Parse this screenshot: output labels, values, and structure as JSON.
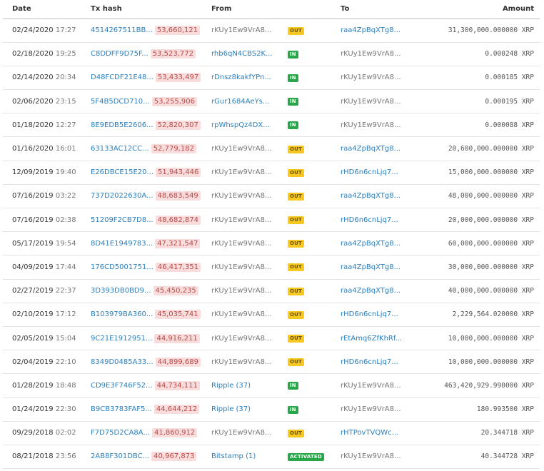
{
  "headers": {
    "date": "Date",
    "tx_hash": "Tx hash",
    "from": "From",
    "to": "To",
    "amount": "Amount"
  },
  "badge_colors": {
    "OUT": "#f7c81f",
    "IN": "#2aa64a",
    "ACTIVATED": "#2aa64a"
  },
  "rows": [
    {
      "date": "02/24/2020",
      "time": "17:27",
      "hash": "4514267511BB...",
      "ledger": "53,660,121",
      "from": "rKUy1Ew9VrA8...",
      "from_link": false,
      "type": "OUT",
      "to": "raa4ZpBqXTg8...",
      "to_link": true,
      "amount": "31,300,000.000000 XRP"
    },
    {
      "date": "02/18/2020",
      "time": "19:25",
      "hash": "C8DDFF9D75F...",
      "ledger": "53,523,772",
      "from": "rhb6qN4CBS2K...",
      "from_link": true,
      "type": "IN",
      "to": "rKUy1Ew9VrA8...",
      "to_link": false,
      "amount": "0.000248 XRP"
    },
    {
      "date": "02/14/2020",
      "time": "20:34",
      "hash": "D48FCDF21E48...",
      "ledger": "53,433,497",
      "from": "rDnsz8kakfYPn...",
      "from_link": true,
      "type": "IN",
      "to": "rKUy1Ew9VrA8...",
      "to_link": false,
      "amount": "0.000185 XRP"
    },
    {
      "date": "02/06/2020",
      "time": "23:15",
      "hash": "5F4B5DCD710...",
      "ledger": "53,255,906",
      "from": "rGur1684AeYs...",
      "from_link": true,
      "type": "IN",
      "to": "rKUy1Ew9VrA8...",
      "to_link": false,
      "amount": "0.000195 XRP"
    },
    {
      "date": "01/18/2020",
      "time": "12:27",
      "hash": "8E9EDB5E2606...",
      "ledger": "52,820,307",
      "from": "rpWhspQz4DX...",
      "from_link": true,
      "type": "IN",
      "to": "rKUy1Ew9VrA8...",
      "to_link": false,
      "amount": "0.000088 XRP"
    },
    {
      "date": "01/16/2020",
      "time": "16:01",
      "hash": "63133AC12CC...",
      "ledger": "52,779,182",
      "from": "rKUy1Ew9VrA8...",
      "from_link": false,
      "type": "OUT",
      "to": "raa4ZpBqXTg8...",
      "to_link": true,
      "amount": "20,600,000.000000 XRP"
    },
    {
      "date": "12/09/2019",
      "time": "19:40",
      "hash": "E26DBCE15E20...",
      "ledger": "51,943,446",
      "from": "rKUy1Ew9VrA8...",
      "from_link": false,
      "type": "OUT",
      "to": "rHD6n6cnLjq7...",
      "to_link": true,
      "amount": "15,000,000.000000 XRP"
    },
    {
      "date": "07/16/2019",
      "time": "03:22",
      "hash": "737D2022630A...",
      "ledger": "48,683,549",
      "from": "rKUy1Ew9VrA8...",
      "from_link": false,
      "type": "OUT",
      "to": "raa4ZpBqXTg8...",
      "to_link": true,
      "amount": "48,000,000.000000 XRP"
    },
    {
      "date": "07/16/2019",
      "time": "02:38",
      "hash": "51209F2CB7D8...",
      "ledger": "48,682,874",
      "from": "rKUy1Ew9VrA8...",
      "from_link": false,
      "type": "OUT",
      "to": "rHD6n6cnLjq7...",
      "to_link": true,
      "amount": "20,000,000.000000 XRP"
    },
    {
      "date": "05/17/2019",
      "time": "19:54",
      "hash": "8D41E1949783...",
      "ledger": "47,321,547",
      "from": "rKUy1Ew9VrA8...",
      "from_link": false,
      "type": "OUT",
      "to": "raa4ZpBqXTg8...",
      "to_link": true,
      "amount": "60,000,000.000000 XRP"
    },
    {
      "date": "04/09/2019",
      "time": "17:44",
      "hash": "176CD5001751...",
      "ledger": "46,417,351",
      "from": "rKUy1Ew9VrA8...",
      "from_link": false,
      "type": "OUT",
      "to": "raa4ZpBqXTg8...",
      "to_link": true,
      "amount": "30,000,000.000000 XRP"
    },
    {
      "date": "02/27/2019",
      "time": "22:37",
      "hash": "3D393DB0BD9...",
      "ledger": "45,450,235",
      "from": "rKUy1Ew9VrA8...",
      "from_link": false,
      "type": "OUT",
      "to": "raa4ZpBqXTg8...",
      "to_link": true,
      "amount": "40,000,000.000000 XRP"
    },
    {
      "date": "02/10/2019",
      "time": "17:12",
      "hash": "B103979BA360...",
      "ledger": "45,035,741",
      "from": "rKUy1Ew9VrA8...",
      "from_link": false,
      "type": "OUT",
      "to": "rHD6n6cnLjq7...",
      "to_link": true,
      "amount": "2,229,564.020000 XRP"
    },
    {
      "date": "02/05/2019",
      "time": "15:04",
      "hash": "9C21E1912951...",
      "ledger": "44,916,211",
      "from": "rKUy1Ew9VrA8...",
      "from_link": false,
      "type": "OUT",
      "to": "rEtAmq6ZfKhRf...",
      "to_link": true,
      "amount": "10,000,000.000000 XRP"
    },
    {
      "date": "02/04/2019",
      "time": "22:10",
      "hash": "8349D0485A33...",
      "ledger": "44,899,689",
      "from": "rKUy1Ew9VrA8...",
      "from_link": false,
      "type": "OUT",
      "to": "rHD6n6cnLjq7...",
      "to_link": true,
      "amount": "10,000,000.000000 XRP"
    },
    {
      "date": "01/28/2019",
      "time": "18:48",
      "hash": "CD9E3F746F52...",
      "ledger": "44,734,111",
      "from": "Ripple (37)",
      "from_link": true,
      "type": "IN",
      "to": "rKUy1Ew9VrA8...",
      "to_link": false,
      "amount": "463,420,929.990000 XRP"
    },
    {
      "date": "01/24/2019",
      "time": "22:30",
      "hash": "B9CB3783FAF5...",
      "ledger": "44,644,212",
      "from": "Ripple (37)",
      "from_link": true,
      "type": "IN",
      "to": "rKUy1Ew9VrA8...",
      "to_link": false,
      "amount": "180.993500 XRP"
    },
    {
      "date": "09/29/2018",
      "time": "02:02",
      "hash": "F7D75D2CA8A...",
      "ledger": "41,860,912",
      "from": "rKUy1Ew9VrA8...",
      "from_link": false,
      "type": "OUT",
      "to": "rHTPovTVQWc...",
      "to_link": true,
      "amount": "20.344718 XRP"
    },
    {
      "date": "08/21/2018",
      "time": "23:56",
      "hash": "2AB8F301DBC...",
      "ledger": "40,967,873",
      "from": "Bitstamp (1)",
      "from_link": true,
      "type": "ACTIVATED",
      "to": "rKUy1Ew9VrA8...",
      "to_link": false,
      "amount": "40.344728 XRP"
    }
  ]
}
